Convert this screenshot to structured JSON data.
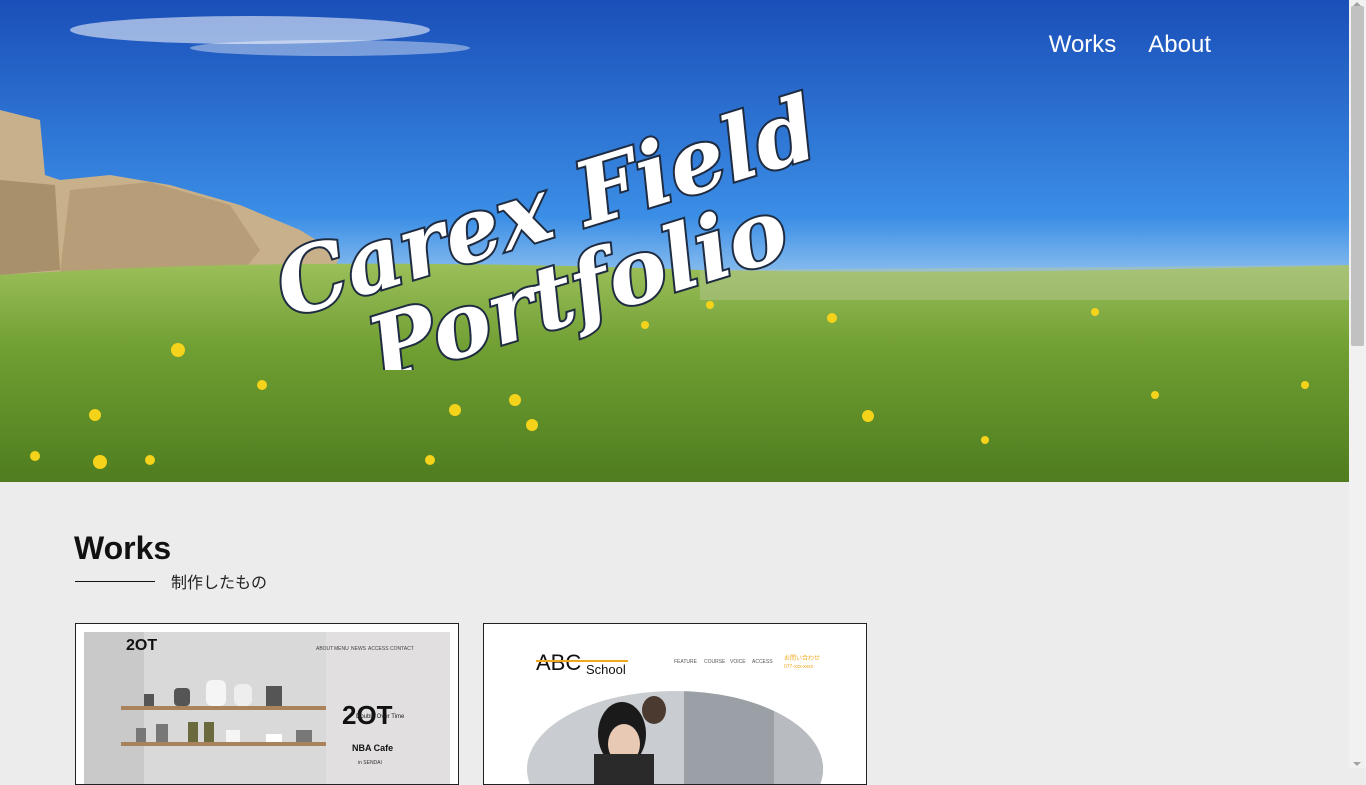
{
  "nav": {
    "items": [
      {
        "label": "Works"
      },
      {
        "label": "About"
      }
    ]
  },
  "hero": {
    "title_line1": "Carex Field",
    "title_line2": "Portfolio"
  },
  "works": {
    "heading": "Works",
    "subheading": "制作したもの",
    "cards": [
      {
        "logo": "2OT",
        "menu": [
          "ABOUT",
          "MENU",
          "NEWS",
          "ACCESS",
          "CONTACT"
        ],
        "tagline": "Double Over Time",
        "name": "NBA Cafe",
        "location": "in SENDAI"
      },
      {
        "logo_abc": "ABC",
        "logo_school": "School",
        "menu": [
          "FEATURE",
          "COURSE",
          "VOICE",
          "ACCESS"
        ],
        "contact_label": "お問い合わせ",
        "contact_phone": "077-xxx-xxxx"
      }
    ]
  }
}
